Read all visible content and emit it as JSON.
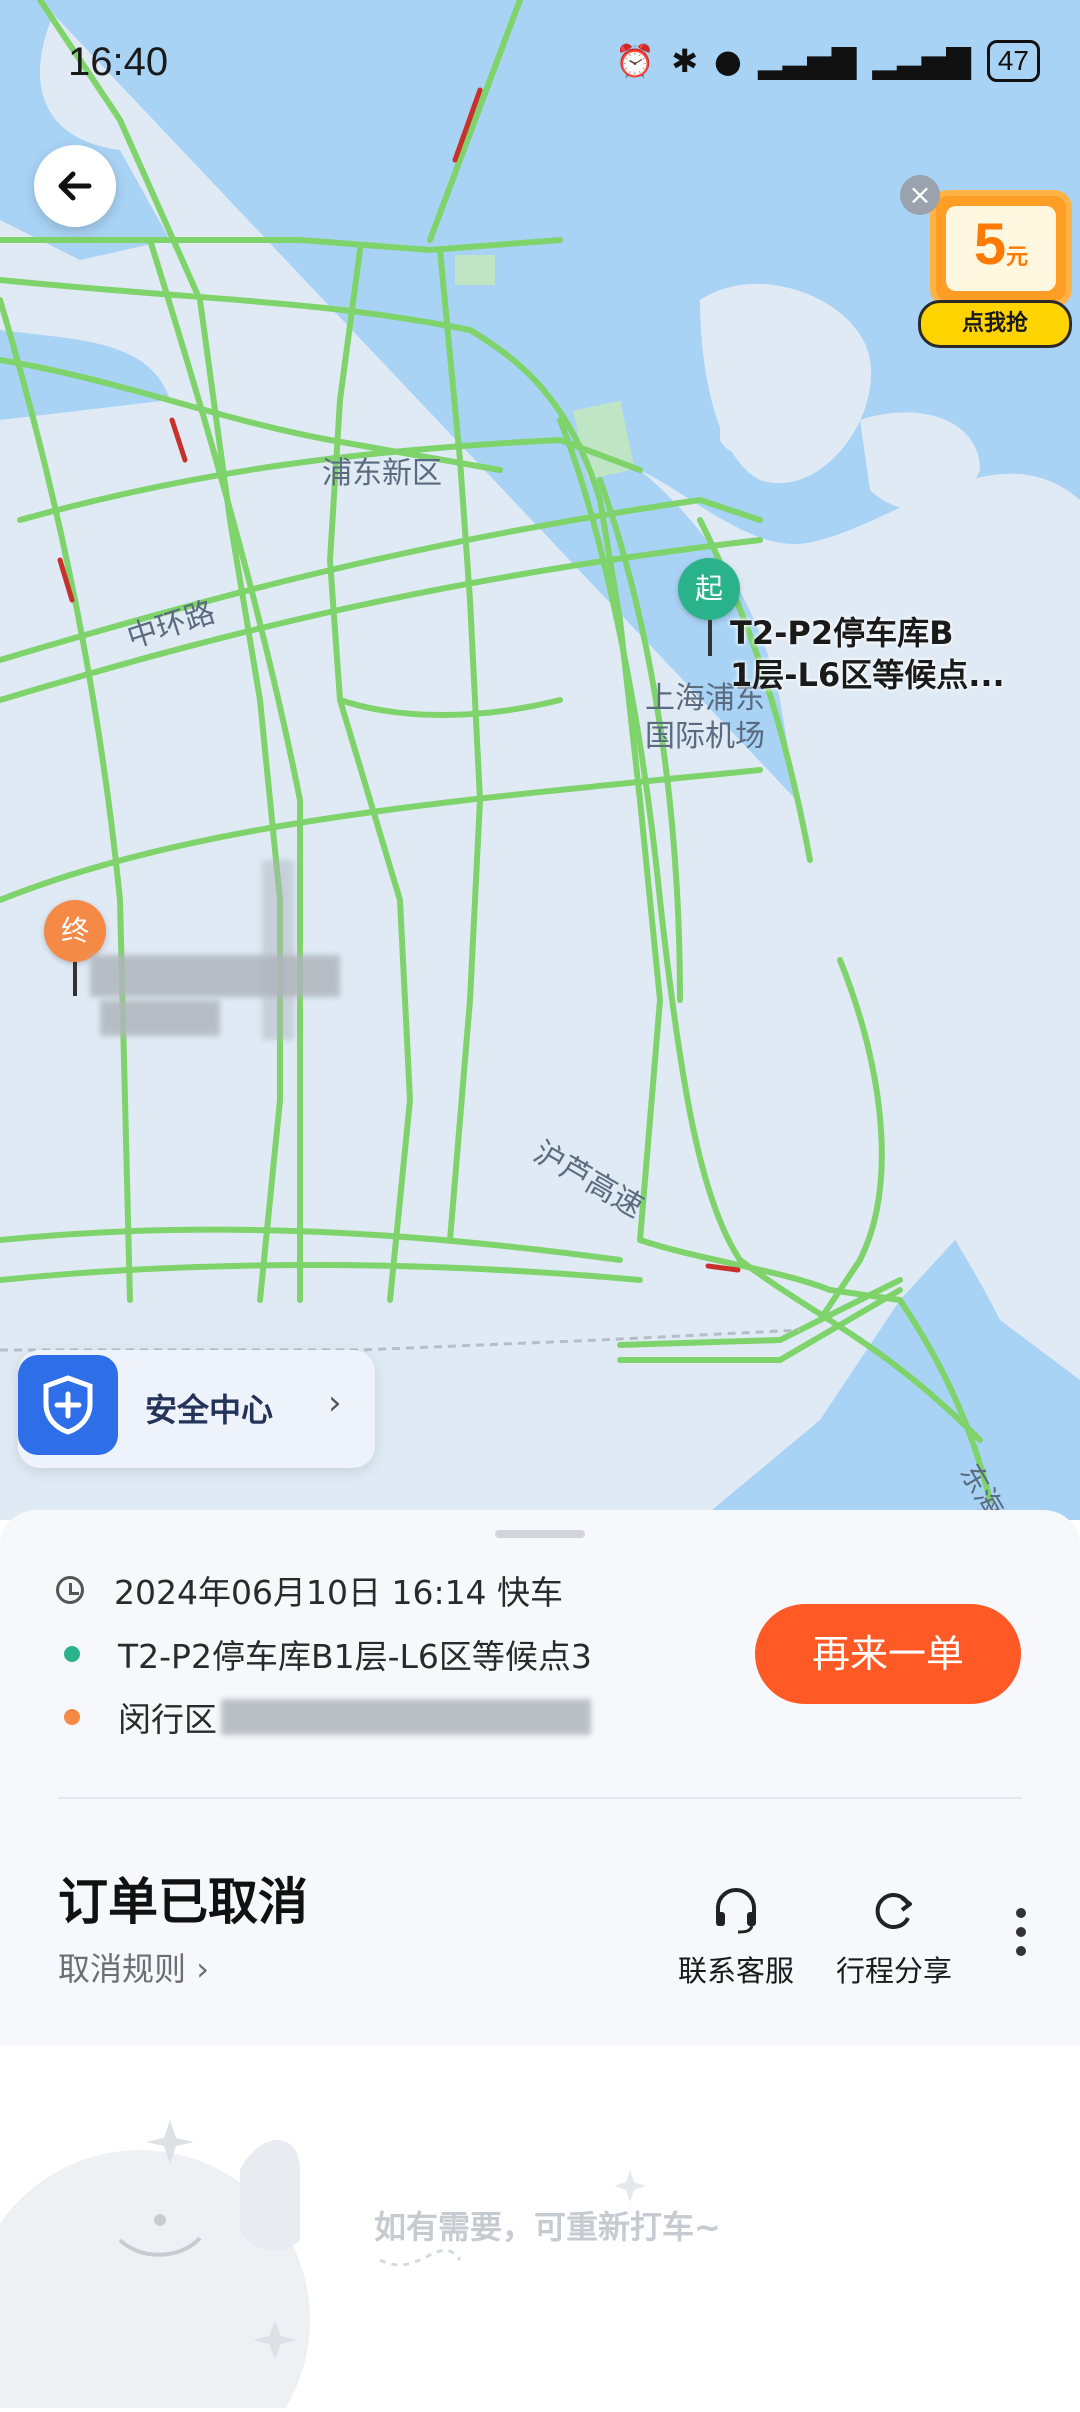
{
  "status_bar": {
    "time": "16:40",
    "battery": "47"
  },
  "promo": {
    "amount": "5",
    "unit": "元",
    "cta": "点我抢",
    "close": "×"
  },
  "map": {
    "labels": {
      "pudong": "浦东新区",
      "zhonghuan": "中环路",
      "airport_line1": "上海浦东",
      "airport_line2": "国际机场",
      "hulu": "沪芦高速",
      "dong": "东海"
    },
    "start_marker": "起",
    "end_marker": "终",
    "start_label_line1": "T2-P2停车库B",
    "start_label_line2": "1层-L6区等候点..."
  },
  "safety_center": {
    "label": "安全中心"
  },
  "order": {
    "time_line": "2024年06月10日 16:14 快车",
    "pickup": "T2-P2停车库B1层-L6区等候点3",
    "dropoff": "闵行区",
    "reorder_button": "再来一单",
    "status_title": "订单已取消",
    "cancel_rules": "取消规则",
    "actions": [
      {
        "label": "联系客服"
      },
      {
        "label": "行程分享"
      }
    ]
  },
  "footer": {
    "hint": "如有需要，可重新打车~"
  },
  "colors": {
    "accent": "#ff5a26",
    "road": "#7fd36b",
    "water": "#a9d3f5",
    "start": "#2ab38a",
    "end": "#f48a45"
  }
}
